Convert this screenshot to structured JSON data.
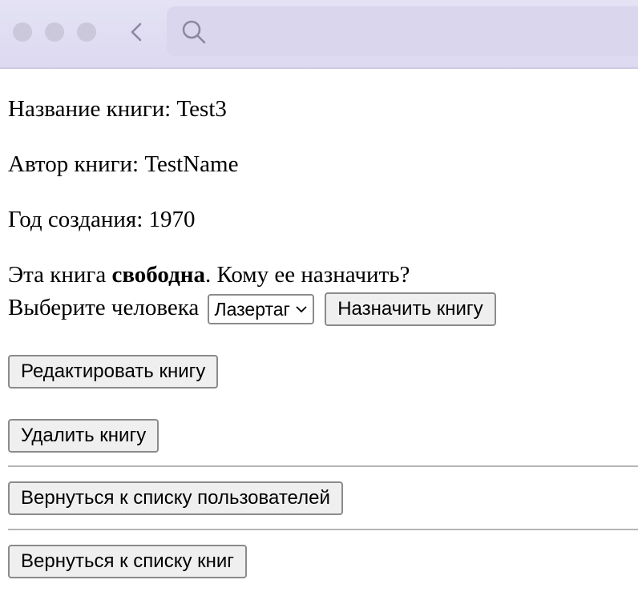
{
  "book": {
    "title_label": "Название книги: ",
    "title_value": "Test3",
    "author_label": "Автор книги: ",
    "author_value": "TestName",
    "year_label": "Год создания: ",
    "year_value": "1970"
  },
  "assign": {
    "status_prefix": "Эта книга ",
    "status_word": "свободна",
    "status_suffix": ". Кому ее назначить?",
    "choose_label": "Выберите человека",
    "selected_person": "Лазертаг",
    "assign_button": "Назначить книгу"
  },
  "actions": {
    "edit_button": "Редактировать книгу",
    "delete_button": "Удалить книгу",
    "back_users_button": "Вернуться к списку пользователей",
    "back_books_button": "Вернуться к списку книг"
  }
}
